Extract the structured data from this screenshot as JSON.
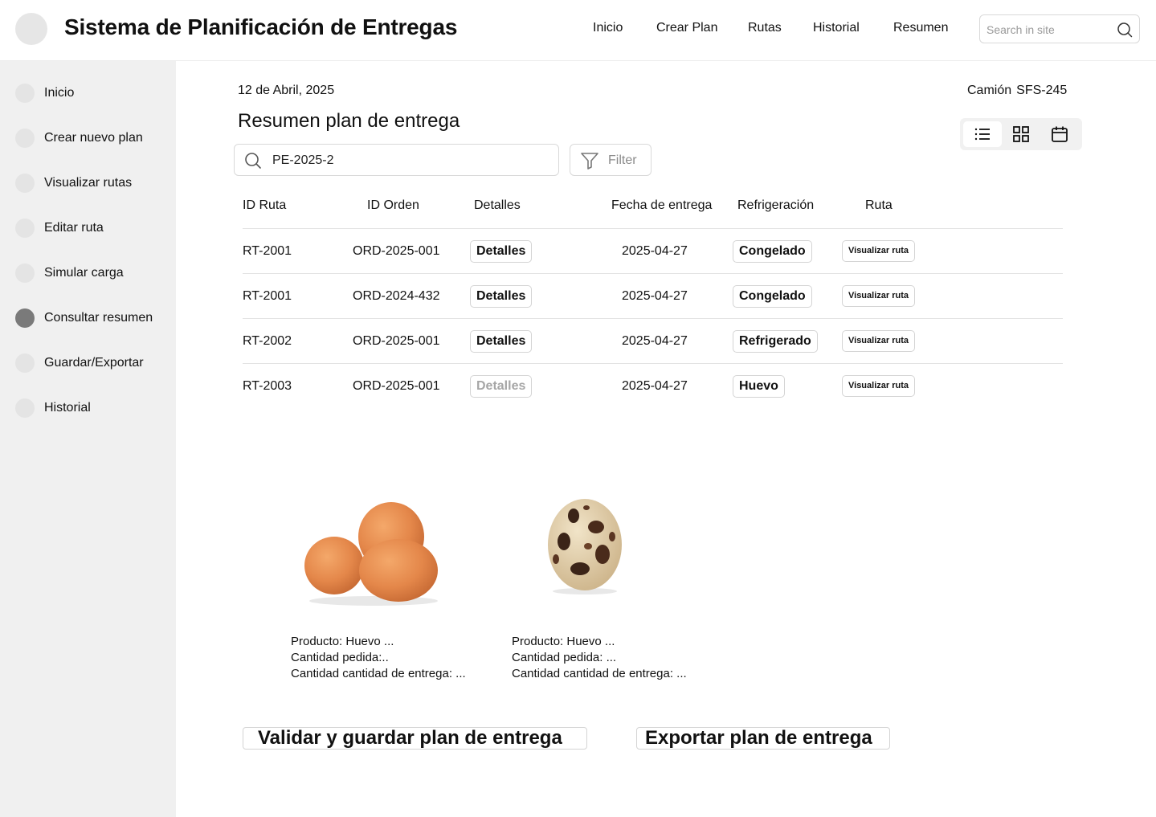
{
  "app": {
    "title": "Sistema de Planificación de Entregas"
  },
  "topnav": {
    "items": [
      {
        "label": "Inicio"
      },
      {
        "label": "Crear Plan"
      },
      {
        "label": "Rutas"
      },
      {
        "label": "Historial"
      },
      {
        "label": "Resumen"
      }
    ],
    "search_placeholder": "Search in site"
  },
  "sidebar": {
    "items": [
      {
        "label": "Inicio",
        "active": false
      },
      {
        "label": "Crear nuevo plan",
        "active": false
      },
      {
        "label": "Visualizar rutas",
        "active": false
      },
      {
        "label": "Editar ruta",
        "active": false
      },
      {
        "label": "Simular carga",
        "active": false
      },
      {
        "label": "Consultar resumen",
        "active": true
      },
      {
        "label": "Guardar/Exportar",
        "active": false
      },
      {
        "label": "Historial",
        "active": false
      }
    ]
  },
  "main": {
    "date": "12 de Abril, 2025",
    "truck_label": "Camión",
    "truck_id": "SFS-245",
    "title": "Resumen plan de entrega",
    "search_value": "PE-2025-2",
    "filter_label": "Filter",
    "view_modes": [
      "list-icon",
      "grid-icon",
      "calendar-icon"
    ],
    "active_view": "list-icon"
  },
  "table": {
    "headers": {
      "route_id": "ID Ruta",
      "order_id": "ID Orden",
      "details": "Detalles",
      "delivery_date": "Fecha de entrega",
      "refrigeration": "Refrigeración",
      "route": "Ruta"
    },
    "rows": [
      {
        "route_id": "RT-2001",
        "order_id": "ORD-2025-001",
        "details": "Detalles",
        "details_enabled": true,
        "delivery_date": "2025-04-27",
        "refrigeration": "Congelado",
        "route_action": "Visualizar ruta"
      },
      {
        "route_id": "RT-2001",
        "order_id": "ORD-2024-432",
        "details": "Detalles",
        "details_enabled": true,
        "delivery_date": "2025-04-27",
        "refrigeration": "Congelado",
        "route_action": "Visualizar ruta"
      },
      {
        "route_id": "RT-2002",
        "order_id": "ORD-2025-001",
        "details": "Detalles",
        "details_enabled": true,
        "delivery_date": "2025-04-27",
        "refrigeration": "Refrigerado",
        "route_action": "Visualizar ruta"
      },
      {
        "route_id": "RT-2003",
        "order_id": "ORD-2025-001",
        "details": "Detalles",
        "details_enabled": false,
        "delivery_date": "2025-04-27",
        "refrigeration": "Huevo",
        "route_action": "Visualizar ruta"
      }
    ]
  },
  "products": [
    {
      "image": "brown-eggs-image",
      "line1": "Producto: Huevo ...",
      "line2": "Cantidad pedida:..",
      "line3": "Cantidad cantidad de entrega: ..."
    },
    {
      "image": "quail-egg-image",
      "line1": "Producto: Huevo ...",
      "line2": "Cantidad pedida: ...",
      "line3": "Cantidad cantidad de entrega: ..."
    }
  ],
  "actions": {
    "validate_save": "Validar y guardar plan de entrega",
    "export": "Exportar plan de entrega"
  }
}
